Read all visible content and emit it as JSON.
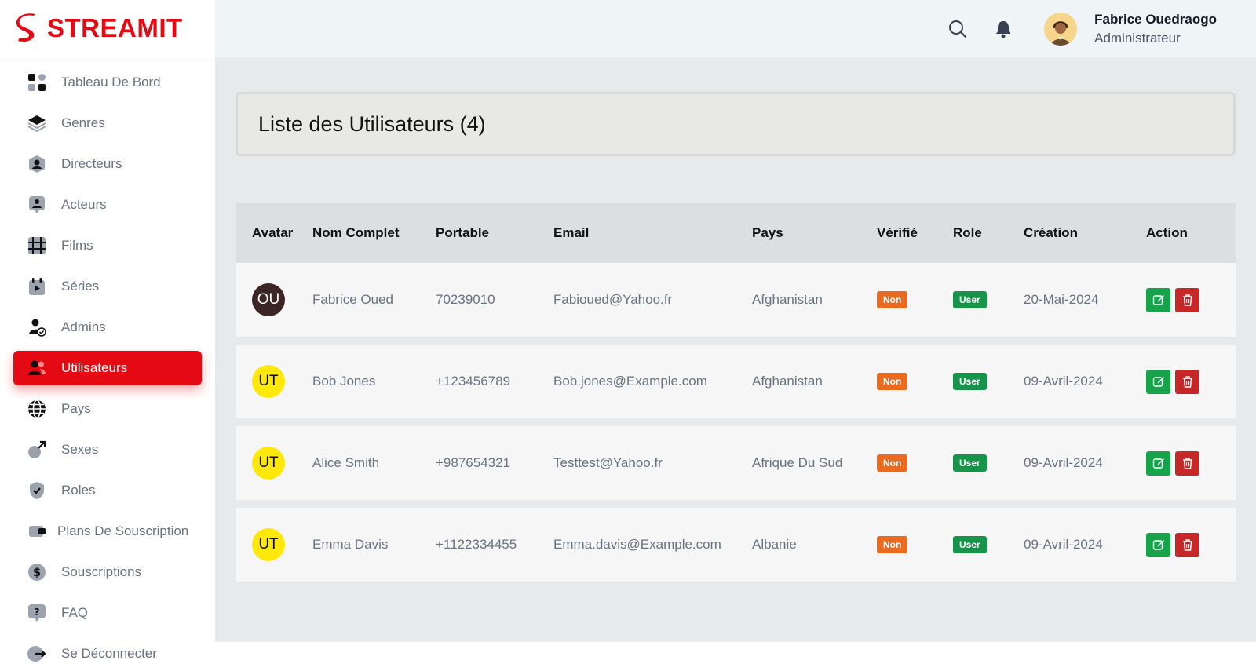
{
  "brand": {
    "name": "STREAMIT",
    "accent": "#e50914"
  },
  "sidebar": {
    "items": [
      {
        "label": "Tableau De Bord",
        "icon": "dashboard-icon"
      },
      {
        "label": "Genres",
        "icon": "layers-icon"
      },
      {
        "label": "Directeurs",
        "icon": "director-icon"
      },
      {
        "label": "Acteurs",
        "icon": "actor-icon"
      },
      {
        "label": "Films",
        "icon": "film-icon"
      },
      {
        "label": "Séries",
        "icon": "series-icon"
      },
      {
        "label": "Admins",
        "icon": "admin-icon"
      },
      {
        "label": "Utilisateurs",
        "icon": "users-icon",
        "active": true
      },
      {
        "label": "Pays",
        "icon": "globe-icon"
      },
      {
        "label": "Sexes",
        "icon": "gender-icon"
      },
      {
        "label": "Roles",
        "icon": "shield-check-icon"
      },
      {
        "label": "Plans De Souscription",
        "icon": "ticket-icon"
      },
      {
        "label": "Souscriptions",
        "icon": "dollar-icon"
      },
      {
        "label": "FAQ",
        "icon": "question-icon"
      },
      {
        "label": "Se Déconnecter",
        "icon": "logout-icon"
      }
    ]
  },
  "header": {
    "user_name": "Fabrice Ouedraogo",
    "user_role": "Administrateur"
  },
  "page": {
    "title": "Liste des Utilisateurs (4)"
  },
  "table": {
    "columns": [
      "Avatar",
      "Nom Complet",
      "Portable",
      "Email",
      "Pays",
      "Vérifié",
      "Role",
      "Création",
      "Action"
    ],
    "rows": [
      {
        "initials": "OU",
        "avatar_bg": "#3b2525",
        "avatar_fg": "#ffffff",
        "name": "Fabrice Oued",
        "phone": "70239010",
        "email": "Fabioued@Yahoo.fr",
        "country": "Afghanistan",
        "verified": "Non",
        "role": "User",
        "created": "20-Mai-2024"
      },
      {
        "initials": "UT",
        "avatar_bg": "#fde80a",
        "avatar_fg": "#111111",
        "name": "Bob Jones",
        "phone": "+123456789",
        "email": "Bob.jones@Example.com",
        "country": "Afghanistan",
        "verified": "Non",
        "role": "User",
        "created": "09-Avril-2024"
      },
      {
        "initials": "UT",
        "avatar_bg": "#fde80a",
        "avatar_fg": "#111111",
        "name": "Alice Smith",
        "phone": "+987654321",
        "email": "Testtest@Yahoo.fr",
        "country": "Afrique Du Sud",
        "verified": "Non",
        "role": "User",
        "created": "09-Avril-2024"
      },
      {
        "initials": "UT",
        "avatar_bg": "#fde80a",
        "avatar_fg": "#111111",
        "name": "Emma Davis",
        "phone": "+1122334455",
        "email": "Emma.davis@Example.com",
        "country": "Albanie",
        "verified": "Non",
        "role": "User",
        "created": "09-Avril-2024"
      }
    ],
    "colors": {
      "verified_no": "#ea6a1f",
      "role_user": "#17934a",
      "edit": "#16a34a",
      "delete": "#c62828"
    }
  }
}
